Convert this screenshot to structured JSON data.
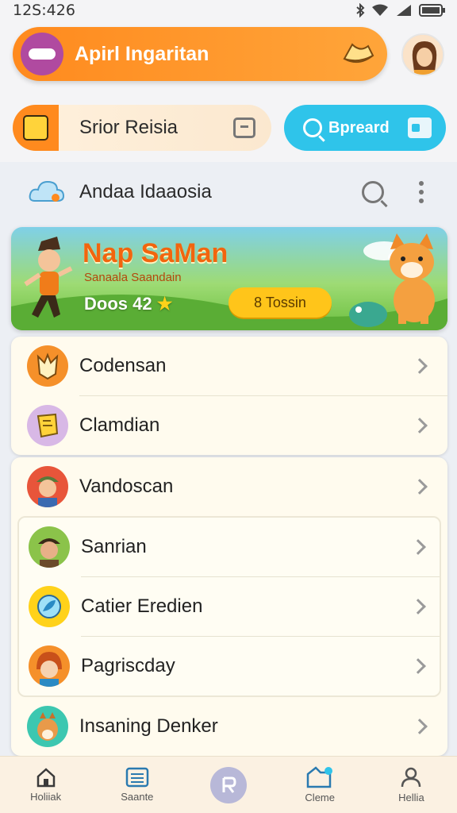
{
  "status_bar": {
    "time": "12S:426"
  },
  "header": {
    "app_title": "Apirl Ingaritan"
  },
  "quick_row": {
    "card_label": "Srior Reisia",
    "search_label": "Bpreard"
  },
  "section": {
    "title": "Andaa Idaaosia"
  },
  "banner": {
    "title": "Nap SaMan",
    "subtitle": "Sanaala Saandain",
    "score": "Doos 42",
    "button_label": "8 Tossin"
  },
  "list_group_1": [
    {
      "label": "Codensan",
      "icon": "fox-icon",
      "color": "#f5902a"
    },
    {
      "label": "Clamdian",
      "icon": "scroll-icon",
      "color": "#d8b8e6"
    }
  ],
  "list_group_2": {
    "top": {
      "label": "Vandoscan",
      "icon": "soldier-avatar-icon",
      "color": "#e8553a"
    },
    "nested": [
      {
        "label": "Sanrian",
        "icon": "adventurer-avatar-icon",
        "color": "#8bc34a"
      },
      {
        "label": "Catier Eredien",
        "icon": "leaf-badge-icon",
        "color": "#ffd21a"
      },
      {
        "label": "Pagriscday",
        "icon": "redhead-avatar-icon",
        "color": "#f5902a"
      }
    ],
    "bottom": {
      "label": "Insaning Denker",
      "icon": "squirrel-icon",
      "color": "#3cc7b0"
    }
  },
  "bottom_nav": [
    {
      "label": "Holiiak",
      "icon": "home-icon"
    },
    {
      "label": "Saante",
      "icon": "list-icon"
    },
    {
      "label": "",
      "icon": "center-action-icon"
    },
    {
      "label": "Cleme",
      "icon": "folder-notification-icon"
    },
    {
      "label": "Hellia",
      "icon": "profile-icon"
    }
  ],
  "colors": {
    "accent_orange": "#ff8a1e",
    "accent_blue": "#2fc4ea",
    "banner_button": "#ffc51a",
    "card_background": "#fffbee"
  }
}
